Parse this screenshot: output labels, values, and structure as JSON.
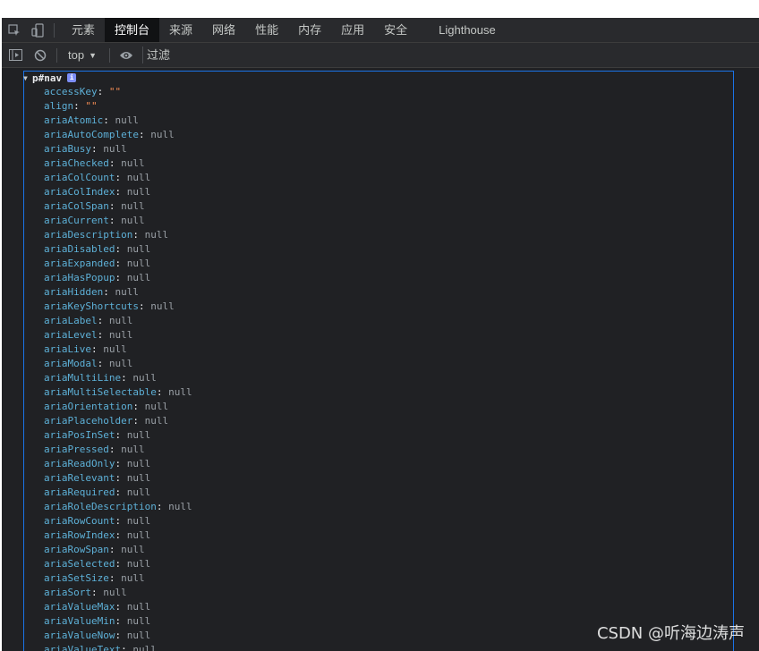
{
  "tabs": [
    {
      "label": "元素"
    },
    {
      "label": "控制台",
      "active": true
    },
    {
      "label": "来源"
    },
    {
      "label": "网络"
    },
    {
      "label": "性能"
    },
    {
      "label": "内存"
    },
    {
      "label": "应用"
    },
    {
      "label": "安全"
    },
    {
      "label": "Lighthouse"
    }
  ],
  "toolbar": {
    "context": "top",
    "filter_placeholder": "过滤"
  },
  "object": {
    "header": "p#nav",
    "properties": [
      {
        "key": "accessKey",
        "value": "\"\"",
        "type": "string"
      },
      {
        "key": "align",
        "value": "\"\"",
        "type": "string"
      },
      {
        "key": "ariaAtomic",
        "value": "null",
        "type": "null"
      },
      {
        "key": "ariaAutoComplete",
        "value": "null",
        "type": "null"
      },
      {
        "key": "ariaBusy",
        "value": "null",
        "type": "null"
      },
      {
        "key": "ariaChecked",
        "value": "null",
        "type": "null"
      },
      {
        "key": "ariaColCount",
        "value": "null",
        "type": "null"
      },
      {
        "key": "ariaColIndex",
        "value": "null",
        "type": "null"
      },
      {
        "key": "ariaColSpan",
        "value": "null",
        "type": "null"
      },
      {
        "key": "ariaCurrent",
        "value": "null",
        "type": "null"
      },
      {
        "key": "ariaDescription",
        "value": "null",
        "type": "null"
      },
      {
        "key": "ariaDisabled",
        "value": "null",
        "type": "null"
      },
      {
        "key": "ariaExpanded",
        "value": "null",
        "type": "null"
      },
      {
        "key": "ariaHasPopup",
        "value": "null",
        "type": "null"
      },
      {
        "key": "ariaHidden",
        "value": "null",
        "type": "null"
      },
      {
        "key": "ariaKeyShortcuts",
        "value": "null",
        "type": "null"
      },
      {
        "key": "ariaLabel",
        "value": "null",
        "type": "null"
      },
      {
        "key": "ariaLevel",
        "value": "null",
        "type": "null"
      },
      {
        "key": "ariaLive",
        "value": "null",
        "type": "null"
      },
      {
        "key": "ariaModal",
        "value": "null",
        "type": "null"
      },
      {
        "key": "ariaMultiLine",
        "value": "null",
        "type": "null"
      },
      {
        "key": "ariaMultiSelectable",
        "value": "null",
        "type": "null"
      },
      {
        "key": "ariaOrientation",
        "value": "null",
        "type": "null"
      },
      {
        "key": "ariaPlaceholder",
        "value": "null",
        "type": "null"
      },
      {
        "key": "ariaPosInSet",
        "value": "null",
        "type": "null"
      },
      {
        "key": "ariaPressed",
        "value": "null",
        "type": "null"
      },
      {
        "key": "ariaReadOnly",
        "value": "null",
        "type": "null"
      },
      {
        "key": "ariaRelevant",
        "value": "null",
        "type": "null"
      },
      {
        "key": "ariaRequired",
        "value": "null",
        "type": "null"
      },
      {
        "key": "ariaRoleDescription",
        "value": "null",
        "type": "null"
      },
      {
        "key": "ariaRowCount",
        "value": "null",
        "type": "null"
      },
      {
        "key": "ariaRowIndex",
        "value": "null",
        "type": "null"
      },
      {
        "key": "ariaRowSpan",
        "value": "null",
        "type": "null"
      },
      {
        "key": "ariaSelected",
        "value": "null",
        "type": "null"
      },
      {
        "key": "ariaSetSize",
        "value": "null",
        "type": "null"
      },
      {
        "key": "ariaSort",
        "value": "null",
        "type": "null"
      },
      {
        "key": "ariaValueMax",
        "value": "null",
        "type": "null"
      },
      {
        "key": "ariaValueMin",
        "value": "null",
        "type": "null"
      },
      {
        "key": "ariaValueNow",
        "value": "null",
        "type": "null"
      },
      {
        "key": "ariaValueText",
        "value": "null",
        "type": "null"
      }
    ]
  },
  "watermark": "CSDN @听海边涛声",
  "colors": {
    "property_key": "#5db0d7",
    "string_value": "#f28b54",
    "null_value": "#9aa0a6",
    "highlight_border": "#1a73e8"
  }
}
